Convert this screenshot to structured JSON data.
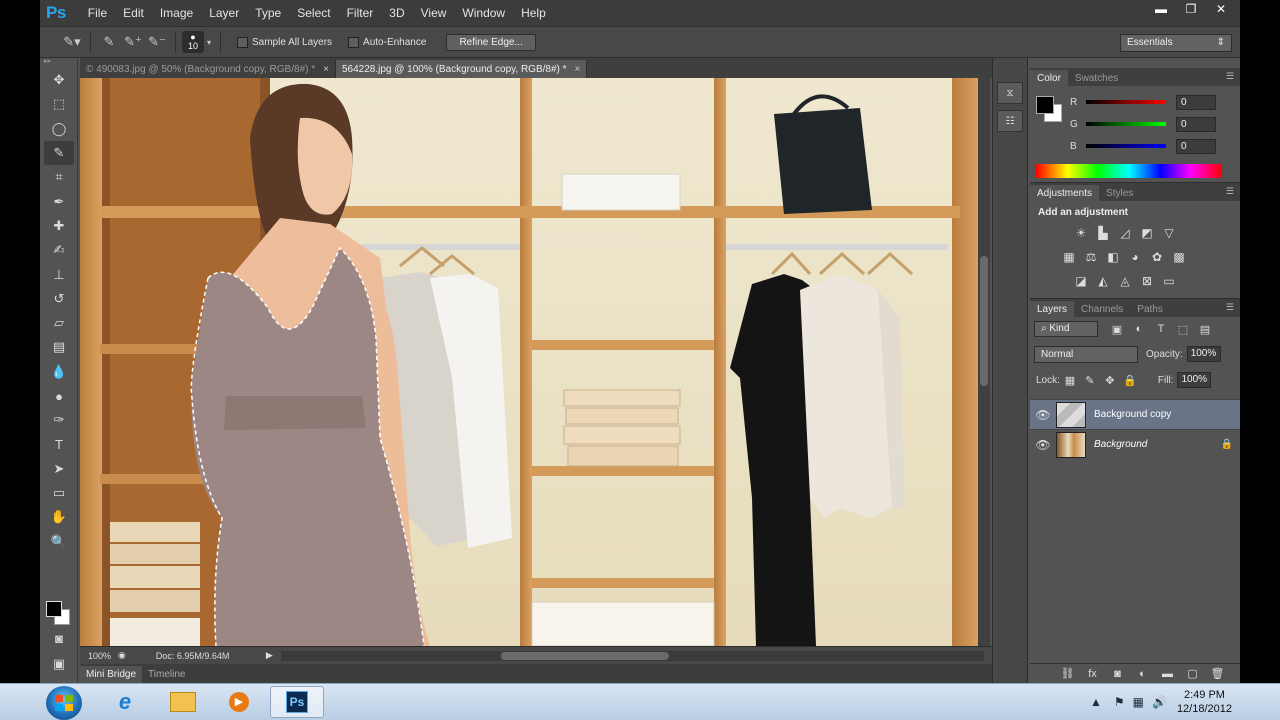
{
  "app": {
    "logo": "Ps"
  },
  "menu": [
    "File",
    "Edit",
    "Image",
    "Layer",
    "Type",
    "Select",
    "Filter",
    "3D",
    "View",
    "Window",
    "Help"
  ],
  "window_controls": {
    "minimize": "▬",
    "restore": "❐",
    "close": "✕"
  },
  "options": {
    "brush_size": "10",
    "sample_all_layers": "Sample All Layers",
    "auto_enhance": "Auto-Enhance",
    "refine_edge": "Refine Edge...",
    "workspace": "Essentials"
  },
  "tabs": [
    {
      "label": "© 490083.jpg @ 50% (Background copy, RGB/8#) *",
      "active": false
    },
    {
      "label": "564228.jpg @ 100% (Background copy, RGB/8#) *",
      "active": true
    }
  ],
  "status": {
    "zoom": "100%",
    "doc": "Doc: 6.95M/9.64M"
  },
  "bottom_tabs": [
    "Mini Bridge",
    "Timeline"
  ],
  "color_panel": {
    "tabs": [
      "Color",
      "Swatches"
    ],
    "channels": [
      {
        "label": "R",
        "value": "0",
        "color": "#ff3b3b"
      },
      {
        "label": "G",
        "value": "0",
        "color": "#3bdc3b"
      },
      {
        "label": "B",
        "value": "0",
        "color": "#3b5bff"
      }
    ]
  },
  "adjustments": {
    "tabs": [
      "Adjustments",
      "Styles"
    ],
    "title": "Add an adjustment"
  },
  "layers_panel": {
    "tabs": [
      "Layers",
      "Channels",
      "Paths"
    ],
    "kind": "Kind",
    "blend_mode": "Normal",
    "opacity_label": "Opacity:",
    "opacity": "100%",
    "lock_label": "Lock:",
    "fill_label": "Fill:",
    "fill": "100%",
    "layers": [
      {
        "name": "Background copy",
        "selected": true,
        "italic": false
      },
      {
        "name": "Background",
        "selected": false,
        "italic": true
      }
    ]
  },
  "taskbar": {
    "time": "2:49 PM",
    "date": "12/18/2012",
    "ps_label": "Ps"
  },
  "colors": {
    "accent": "#2aa4e8",
    "selected_layer": "#6a7488"
  }
}
